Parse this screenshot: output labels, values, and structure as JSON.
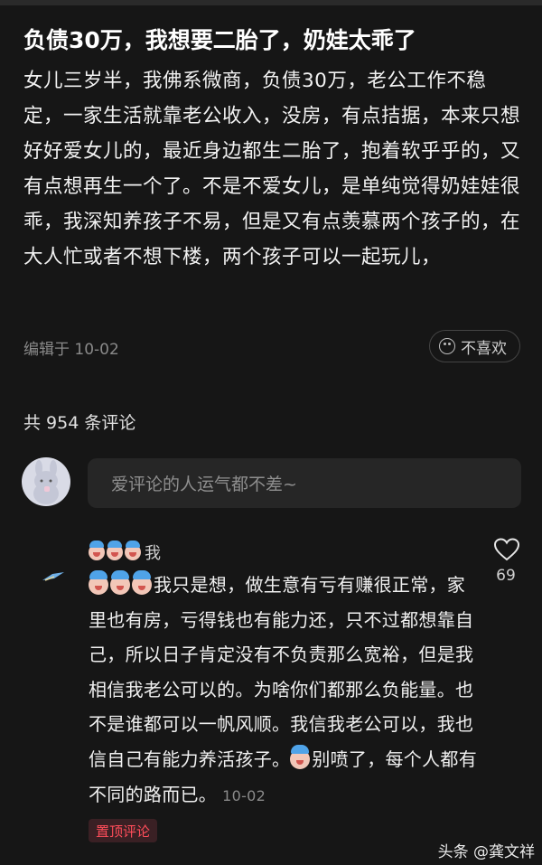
{
  "post": {
    "title": "负债30万，我想要二胎了，奶娃太乖了",
    "body": "女儿三岁半，我佛系微商，负债30万，老公工作不稳定，一家生活就靠老公收入，没房，有点拮据，本来只想好好爱女儿的，最近身边都生二胎了，抱着软乎乎的，又有点想再生一个了。不是不爱女儿，是单纯觉得奶娃娃很乖，我深知养孩子不易，但是又有点羡慕两个孩子的，在大人忙或者不想下楼，两个孩子可以一起玩儿，",
    "meta": "编辑于 10-02",
    "dislike_label": "不喜欢"
  },
  "comments_header": {
    "count_text": "共 954 条评论"
  },
  "comment_input": {
    "placeholder": "爱评论的人运气都不差~"
  },
  "comment": {
    "author": "我",
    "text_part1": "我只是想，做生意有亏有赚很正常，家里也有房，亏得钱也有能力还，只不过都想靠自己，所以日子肯定没有不负责那么宽裕，但是我相信我老公可以的。为啥你们都那么负能量。也不是谁都可以一帆风顺。我信我老公可以，我也信自己有能力养活孩子。",
    "text_part2": "别喷了，每个人都有不同的路而已。",
    "date": "10-02",
    "likes": "69",
    "pin_label": "置顶评论"
  },
  "watermark": "头条 @龚文祥"
}
